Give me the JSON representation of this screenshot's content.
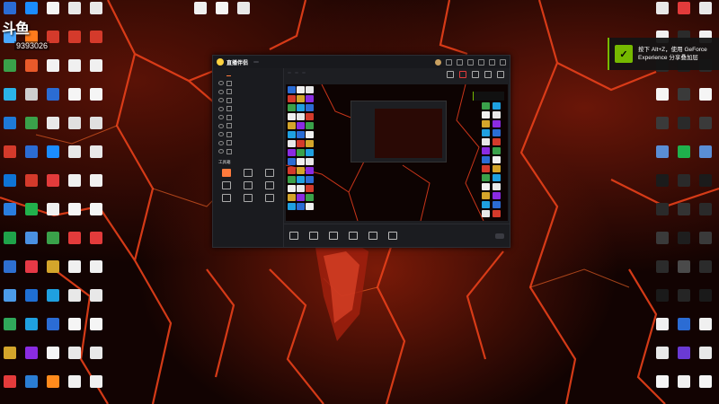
{
  "stream_overlay": {
    "logo_text": "斗鱼",
    "room_number": "9393026"
  },
  "nvidia_toast": {
    "line1": "按下 Alt+Z，使用 GeForce",
    "line2": "Experience 分享叠加层"
  },
  "desktop": {
    "left_col1": [
      {
        "label": "",
        "color": "#2b6cd4"
      },
      {
        "label": "",
        "color": "#4aa8ff"
      },
      {
        "label": "",
        "color": "#3aa14a"
      },
      {
        "label": "",
        "color": "#2bb3e8"
      },
      {
        "label": "",
        "color": "#1e7ad8"
      },
      {
        "label": "",
        "color": "#d43a2b"
      },
      {
        "label": "",
        "color": "#0e74d6"
      },
      {
        "label": "",
        "color": "#2a7ee0"
      },
      {
        "label": "",
        "color": "#1fa34a"
      },
      {
        "label": "",
        "color": "#2e6fd0"
      },
      {
        "label": "",
        "color": "#4c9be8"
      },
      {
        "label": "",
        "color": "#30a85a"
      },
      {
        "label": "",
        "color": "#d4a52b"
      },
      {
        "label": "",
        "color": "#e33b3b"
      }
    ],
    "left_col2": [
      {
        "label": "",
        "color": "#1b8cff"
      },
      {
        "label": "",
        "color": "#ff7a1c"
      },
      {
        "label": "",
        "color": "#e85a2a"
      },
      {
        "label": "",
        "color": "#cfcfcf"
      },
      {
        "label": "",
        "color": "#3aa14a"
      },
      {
        "label": "",
        "color": "#2b6cd4"
      },
      {
        "label": "",
        "color": "#d43a2b"
      },
      {
        "label": "",
        "color": "#22b14c"
      },
      {
        "label": "",
        "color": "#4a90e2"
      },
      {
        "label": "",
        "color": "#e63946"
      },
      {
        "label": "",
        "color": "#1f6fd4"
      },
      {
        "label": "",
        "color": "#1fa0e0"
      },
      {
        "label": "",
        "color": "#8a2be2"
      },
      {
        "label": "",
        "color": "#2b7ed4"
      }
    ],
    "left_col3": [
      {
        "label": "",
        "color": "#f5f5f5"
      },
      {
        "label": "",
        "color": "#d43a2b"
      },
      {
        "label": "",
        "color": "#f2f2f2"
      },
      {
        "label": "",
        "color": "#2b6cd4"
      },
      {
        "label": "",
        "color": "#e8e8e8"
      },
      {
        "label": "",
        "color": "#1b8cff"
      },
      {
        "label": "",
        "color": "#e33b3b"
      },
      {
        "label": "",
        "color": "#f0f0f0"
      },
      {
        "label": "",
        "color": "#3aa14a"
      },
      {
        "label": "",
        "color": "#d4a52b"
      },
      {
        "label": "",
        "color": "#1fa0e0"
      },
      {
        "label": "",
        "color": "#2b6cd4"
      },
      {
        "label": "",
        "color": "#f5f5f5"
      },
      {
        "label": "",
        "color": "#ff8a1c"
      }
    ],
    "left_col4": [
      {
        "label": "",
        "color": "#e8e8e8"
      },
      {
        "label": "",
        "color": "#d43a2b"
      },
      {
        "label": "",
        "color": "#f0f0f0"
      },
      {
        "label": "",
        "color": "#f5f5f5"
      },
      {
        "label": "",
        "color": "#e0e0e0"
      },
      {
        "label": "",
        "color": "#e8e8e8"
      },
      {
        "label": "",
        "color": "#f0f0f0"
      },
      {
        "label": "",
        "color": "#f5f5f5"
      },
      {
        "label": "",
        "color": "#e33b3b"
      },
      {
        "label": "",
        "color": "#f0f0f0"
      },
      {
        "label": "",
        "color": "#e8e8e8"
      },
      {
        "label": "",
        "color": "#f5f5f5"
      },
      {
        "label": "",
        "color": "#e8e8e8"
      },
      {
        "label": "",
        "color": "#f0f0f0"
      }
    ],
    "top_row": [
      {
        "label": "",
        "color": "#f0f0f0"
      },
      {
        "label": "",
        "color": "#f5f5f5"
      },
      {
        "label": "",
        "color": "#e8e8e8"
      }
    ],
    "right_col1": [
      {
        "label": "",
        "color": "#e8e8e8"
      },
      {
        "label": "",
        "color": "#f0f0f0"
      },
      {
        "label": "",
        "color": "#2a2a2a"
      },
      {
        "label": "",
        "color": "#f5f5f5"
      },
      {
        "label": "",
        "color": "#3a3a3a"
      },
      {
        "label": "",
        "color": "#5a8ed6"
      },
      {
        "label": "",
        "color": "#1b1b1b"
      },
      {
        "label": "",
        "color": "#2a2a2a"
      },
      {
        "label": "",
        "color": "#3a3a3a"
      },
      {
        "label": "",
        "color": "#2b2b2b"
      },
      {
        "label": "",
        "color": "#1a1a1a"
      },
      {
        "label": "",
        "color": "#f0f0f0"
      },
      {
        "label": "",
        "color": "#e8e8e8"
      },
      {
        "label": "",
        "color": "#f5f5f5"
      }
    ],
    "right_col2": [
      {
        "label": "",
        "color": "#e33b3b"
      },
      {
        "label": "",
        "color": "#2b2b2b"
      },
      {
        "label": "",
        "color": "#1f1f1f"
      },
      {
        "label": "",
        "color": "#3a3a3a"
      },
      {
        "label": "",
        "color": "#2a2a2a"
      },
      {
        "label": "",
        "color": "#1fb14c"
      },
      {
        "label": "",
        "color": "#2a2a2a"
      },
      {
        "label": "",
        "color": "#333333"
      },
      {
        "label": "",
        "color": "#1e1e1e"
      },
      {
        "label": "",
        "color": "#4a4a4a"
      },
      {
        "label": "",
        "color": "#252525"
      },
      {
        "label": "",
        "color": "#2b6cd4"
      },
      {
        "label": "",
        "color": "#6a3ad4"
      },
      {
        "label": "",
        "color": "#f0f0f0"
      }
    ]
  },
  "app": {
    "brand": "直播伴侣",
    "version_badge": "",
    "sidebar_tabs": [
      {
        "label": "",
        "active": false
      },
      {
        "label": "",
        "active": true
      },
      {
        "label": "",
        "active": false
      }
    ],
    "scenes": [
      {
        "label": ""
      },
      {
        "label": ""
      },
      {
        "label": ""
      },
      {
        "label": ""
      },
      {
        "label": ""
      },
      {
        "label": ""
      },
      {
        "label": ""
      },
      {
        "label": ""
      },
      {
        "label": ""
      }
    ],
    "tools_title": "工具箱",
    "tools": [
      {
        "label": ""
      },
      {
        "label": ""
      },
      {
        "label": ""
      },
      {
        "label": ""
      },
      {
        "label": ""
      },
      {
        "label": ""
      },
      {
        "label": ""
      },
      {
        "label": ""
      },
      {
        "label": ""
      }
    ],
    "footer": "",
    "stream_title": "",
    "sub_tags": [
      "",
      "",
      ""
    ],
    "bottom_actions": [
      {
        "label": ""
      },
      {
        "label": ""
      },
      {
        "label": ""
      },
      {
        "label": ""
      },
      {
        "label": ""
      },
      {
        "label": ""
      }
    ],
    "go_live": ""
  }
}
